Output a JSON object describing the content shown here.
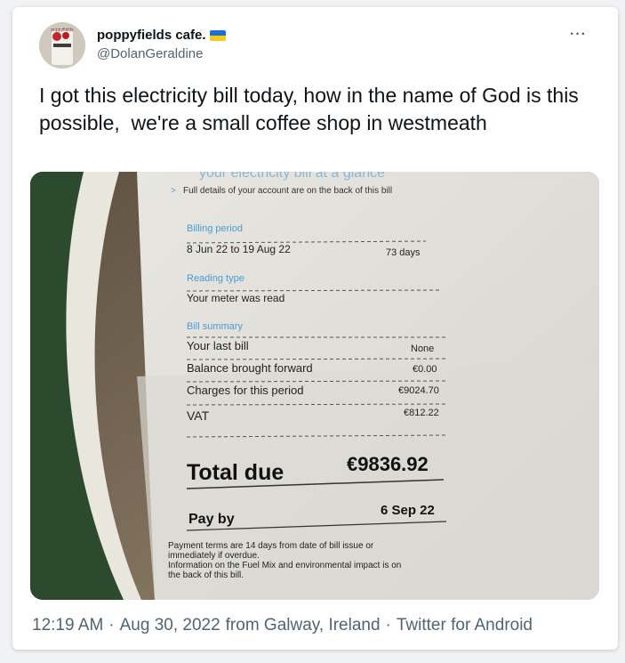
{
  "tweet": {
    "display_name": "poppyfields cafe.",
    "handle": "@DolanGeraldine",
    "text": "I got this electricity bill today, how in the name of God is this possible,  we're a small coffee shop in westmeath",
    "more_icon": "more-horizontal-icon",
    "flag_colors": [
      "#1e6fd0",
      "#f5cc1c"
    ],
    "avatar_label": "poppyfields",
    "time": "12:19 AM",
    "date": "Aug 30, 2022",
    "location": "from Galway, Ireland",
    "client": "Twitter for Android",
    "separator": "·"
  },
  "bill": {
    "header": "your electricity bill at a glance",
    "details_link": "Full details of your account are on the back of this bill",
    "billing_period_label": "Billing period",
    "billing_period_value": "8 Jun 22 to 19 Aug 22",
    "billing_days": "73 days",
    "reading_type_label": "Reading type",
    "reading_type_value": "Your meter was read",
    "summary_label": "Bill summary",
    "rows": [
      {
        "label": "Your last bill",
        "value": "None"
      },
      {
        "label": "Balance brought forward",
        "value": "€0.00"
      },
      {
        "label": "Charges for this period",
        "value": "€9024.70"
      },
      {
        "label": "VAT",
        "value": "€812.22"
      }
    ],
    "total_label": "Total due",
    "total_value": "€9836.92",
    "pay_by_label": "Pay by",
    "pay_by_value": "6 Sep 22",
    "footnote_1": "Payment terms are 14 days from date of bill issue or",
    "footnote_2": "immediately if overdue.",
    "footnote_3": "Information on the Fuel Mix and environmental impact is on",
    "footnote_4": "the back of this bill.",
    "accent_color": "#4a9bd1"
  }
}
